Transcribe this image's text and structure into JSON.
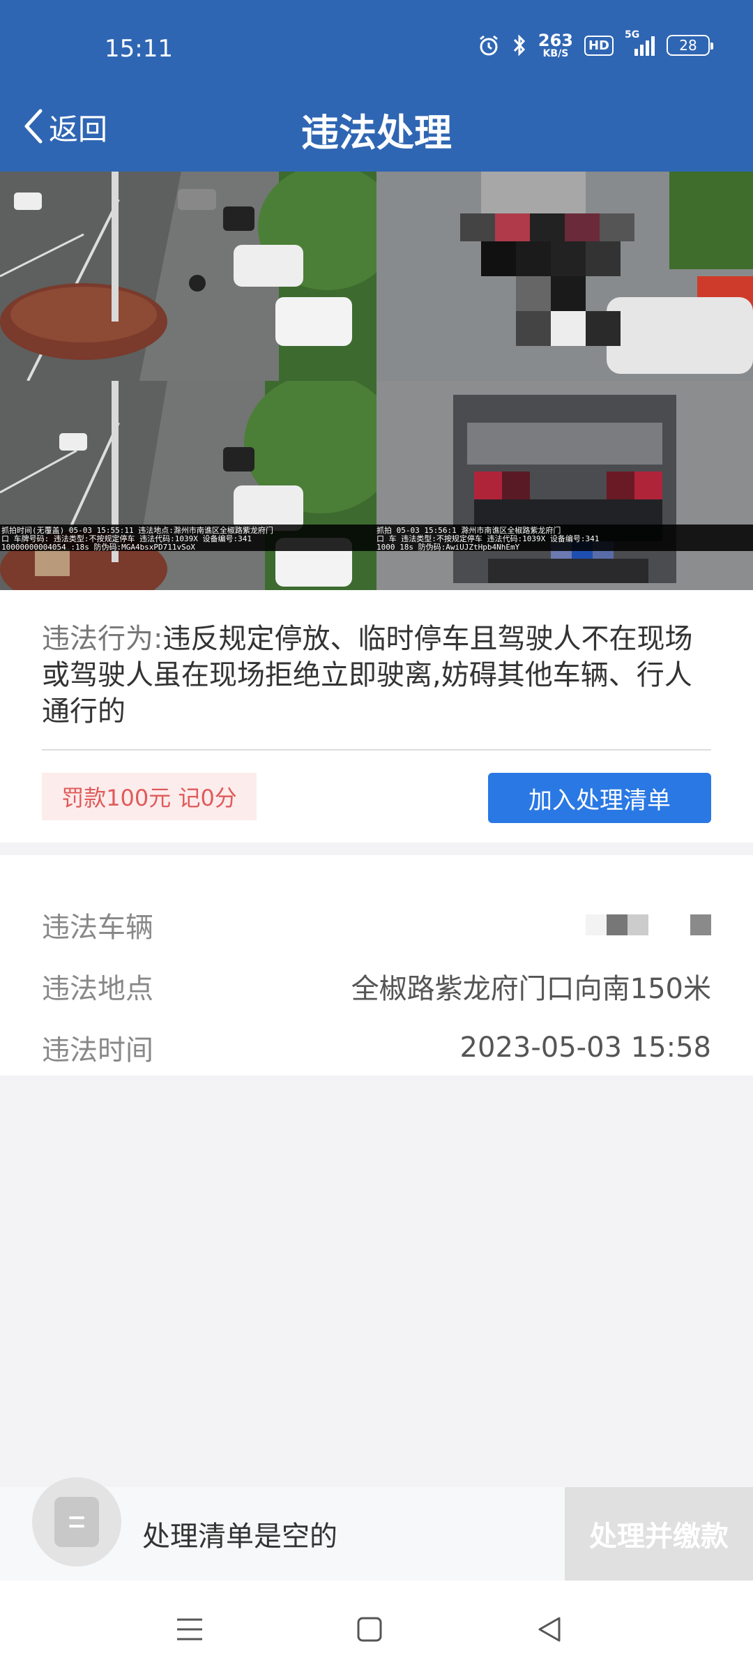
{
  "status_bar": {
    "time": "15:11",
    "net_speed_value": "263",
    "net_speed_unit": "KB/S",
    "hd_label": "HD",
    "network_label": "5G",
    "battery": "28",
    "icons": [
      "alarm-icon",
      "bluetooth-icon",
      "signal-icon",
      "battery-icon"
    ]
  },
  "header": {
    "back_label": "返回",
    "title": "违法处理"
  },
  "photos": {
    "overlay_left_line1": "抓拍时间(无覆盖)  05-03 15:55:11 违法地点:滁州市南谯区全椒路紫龙府门",
    "overlay_left_line2": "口 车牌号码:    违法类型:不按规定停车 违法代码:1039X 设备编号:341",
    "overlay_left_line3": "10000000004054      :18s 防伪码:MGA4bsxPD711vSoX",
    "overlay_right_line1": "抓拍   05-03 15:56:1    滁州市南谯区全椒路紫龙府门",
    "overlay_right_line2": "口 车    违法类型:不按规定停车 违法代码:1039X 设备编号:341",
    "overlay_right_line3": "1000      18s 防伪码:AwiUJZtHpb4NhEmY"
  },
  "violation": {
    "label": "违法行为:",
    "description": "违反规定停放、临时停车且驾驶人不在现场或驾驶人虽在现场拒绝立即驶离,妨碍其他车辆、行人通行的",
    "penalty": "罚款100元 记0分",
    "add_button": "加入处理清单"
  },
  "details": {
    "vehicle_label": "违法车辆",
    "location_label": "违法地点",
    "location_value": "全椒路紫龙府门口向南150米",
    "time_label": "违法时间",
    "time_value": "2023-05-03 15:58"
  },
  "action_bar": {
    "empty_text": "处理清单是空的",
    "pay_button": "处理并缴款"
  },
  "colors": {
    "header_bg": "#2f66b3",
    "primary_button": "#2a78e4",
    "penalty_text": "#e05a5a",
    "penalty_bg": "#fdecec"
  }
}
